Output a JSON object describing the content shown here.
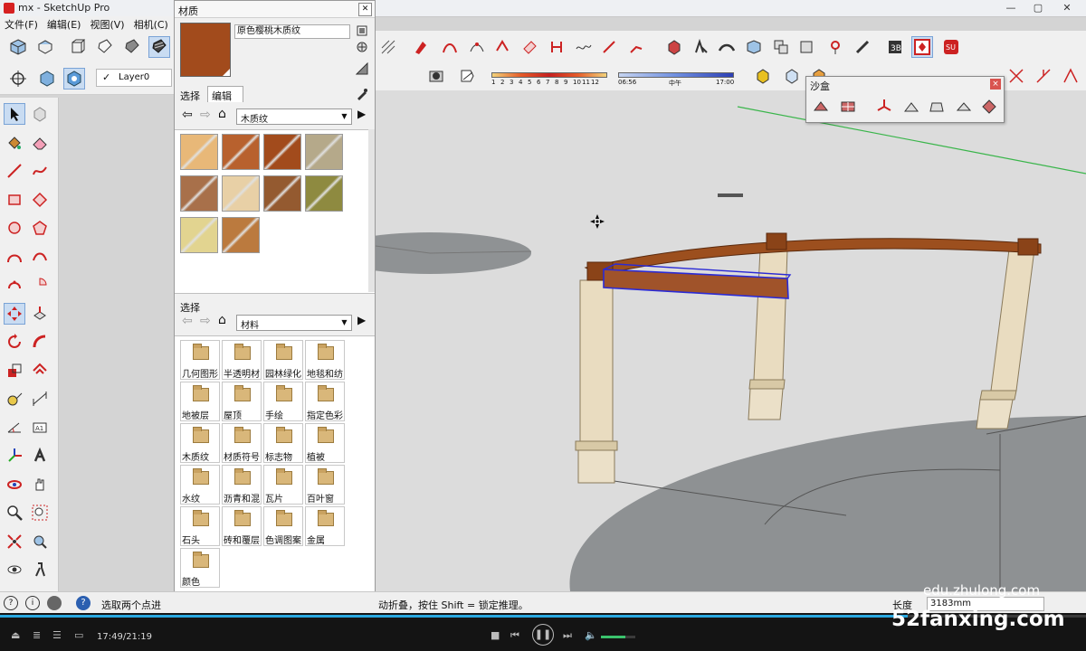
{
  "window": {
    "title": "mx - SketchUp Pro"
  },
  "menu": [
    "文件(F)",
    "编辑(E)",
    "视图(V)",
    "相机(C)"
  ],
  "layer": {
    "check": "✓",
    "name": "Layer0"
  },
  "shadow_settings": {
    "month_ticks": [
      "1",
      "2",
      "3",
      "4",
      "5",
      "6",
      "7",
      "8",
      "9",
      "10",
      "11",
      "12"
    ],
    "time_start": "06:56",
    "time_mid": "中午",
    "time_end": "17:00"
  },
  "materials": {
    "panel_title": "材质",
    "current_name": "原色樱桃木质纹",
    "tabs": [
      "选择",
      "编辑"
    ],
    "top_library": "木质纹",
    "bottom_label": "选择",
    "bottom_library": "材料",
    "swatch_colors": [
      "#e8b878",
      "#b8612e",
      "#a24b1c",
      "#b5a98a",
      "#a8704a",
      "#e8d0a6",
      "#945a30",
      "#8e8a40",
      "#e2d490",
      "#bb7a3e"
    ],
    "folders": [
      "几何图形",
      "半透明材",
      "园林绿化",
      "地毯和纺",
      "地被层",
      "屋顶",
      "手绘",
      "指定色彩",
      "木质纹",
      "材质符号",
      "标志物",
      "植被",
      "水纹",
      "沥青和混",
      "瓦片",
      "百叶窗",
      "石头",
      "砖和覆层",
      "色调图案",
      "金属",
      "颜色"
    ]
  },
  "sandbox": {
    "title": "沙盒",
    "close": "×"
  },
  "status": {
    "message_left": "选取两个点进",
    "message_right": "动折叠，按住 Shift = 锁定推理。",
    "measure_label": "长度",
    "measure_value": "3183mm"
  },
  "player": {
    "time": "17:49/21:19",
    "progress": 0.836
  },
  "watermarks": {
    "site1": "edu.zhulong.com",
    "site2": "52fanxing.com"
  },
  "colors": {
    "accent": "#2aa8e0",
    "beam": "#9c4f1e",
    "column": "#e9dcc0",
    "selection": "#2a2ad6"
  }
}
